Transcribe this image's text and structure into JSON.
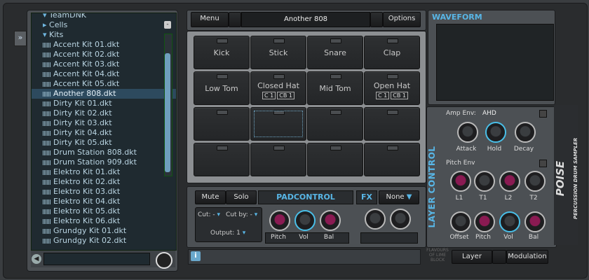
{
  "browser": {
    "items": [
      {
        "type": "folder-open",
        "label": "TeamDNK"
      },
      {
        "type": "folder",
        "label": "Cells"
      },
      {
        "type": "folder-open",
        "label": "Kits"
      },
      {
        "type": "file",
        "label": "Accent Kit 01.dkt"
      },
      {
        "type": "file",
        "label": "Accent Kit 02.dkt"
      },
      {
        "type": "file",
        "label": "Accent Kit 03.dkt"
      },
      {
        "type": "file",
        "label": "Accent Kit 04.dkt"
      },
      {
        "type": "file",
        "label": "Accent Kit 05.dkt"
      },
      {
        "type": "file",
        "label": "Another 808.dkt",
        "selected": true
      },
      {
        "type": "file",
        "label": "Dirty Kit 01.dkt"
      },
      {
        "type": "file",
        "label": "Dirty Kit 02.dkt"
      },
      {
        "type": "file",
        "label": "Dirty Kit 03.dkt"
      },
      {
        "type": "file",
        "label": "Dirty Kit 04.dkt"
      },
      {
        "type": "file",
        "label": "Dirty Kit 05.dkt"
      },
      {
        "type": "file",
        "label": "Drum Station 808.dkt"
      },
      {
        "type": "file",
        "label": "Drum Station 909.dkt"
      },
      {
        "type": "file",
        "label": "Elektro Kit 01.dkt"
      },
      {
        "type": "file",
        "label": "Elektro Kit 02.dkt"
      },
      {
        "type": "file",
        "label": "Elektro Kit 03.dkt"
      },
      {
        "type": "file",
        "label": "Elektro Kit 04.dkt"
      },
      {
        "type": "file",
        "label": "Elektro Kit 05.dkt"
      },
      {
        "type": "file",
        "label": "Elektro Kit 06.dkt"
      },
      {
        "type": "file",
        "label": "Grundgy Kit 01.dkt"
      },
      {
        "type": "file",
        "label": "Grundgy Kit 02.dkt"
      }
    ],
    "toggle_glyph": "»",
    "collapse_glyph": "-"
  },
  "topbar": {
    "menu": "Menu",
    "kit": "Another 808",
    "options": "Options"
  },
  "pads": [
    {
      "label": "Kick"
    },
    {
      "label": "Stick"
    },
    {
      "label": "Snare"
    },
    {
      "label": "Clap"
    },
    {
      "label": "Low Tom"
    },
    {
      "label": "Closed Hat",
      "notes": [
        "C 1",
        "CB 1"
      ]
    },
    {
      "label": "Mid Tom"
    },
    {
      "label": "Open Hat",
      "notes": [
        "C 1",
        "CB 1"
      ]
    },
    {
      "label": ""
    },
    {
      "label": "",
      "active": true
    },
    {
      "label": ""
    },
    {
      "label": ""
    },
    {
      "label": ""
    },
    {
      "label": ""
    },
    {
      "label": ""
    },
    {
      "label": ""
    }
  ],
  "padcontrol": {
    "mute": "Mute",
    "solo": "Solo",
    "title": "PADCONTROL",
    "cut": "Cut: -",
    "cutby": "Cut by: -",
    "output": "Output: 1",
    "knobs": [
      "Pitch",
      "Vol",
      "Bal"
    ],
    "fx": "FX",
    "fx_value": "None"
  },
  "waveform": {
    "title": "WAVEFORM"
  },
  "layer": {
    "title": "LAYER CONTROL",
    "amp_env": "Amp Env:",
    "amp_env_value": "AHD",
    "amp_knobs": [
      "Attack",
      "Hold",
      "Decay"
    ],
    "pitch_env": "Pitch Env",
    "pitch_knobs": [
      "L1",
      "T1",
      "L2",
      "T2"
    ],
    "bottom_knobs": [
      "Offset",
      "Pitch",
      "Vol",
      "Bal"
    ],
    "tabs": [
      "Layer",
      "Modulation"
    ]
  },
  "brand": {
    "name": "POISE",
    "sub": "PERCUSSION DRUM SAMPLER",
    "flavours": "FLAVOURS OF LIME BLOCK"
  },
  "colors": {
    "accent": "#58b6e6",
    "knob_pink": "#8a1a52",
    "selection": "#2d4a5e"
  }
}
